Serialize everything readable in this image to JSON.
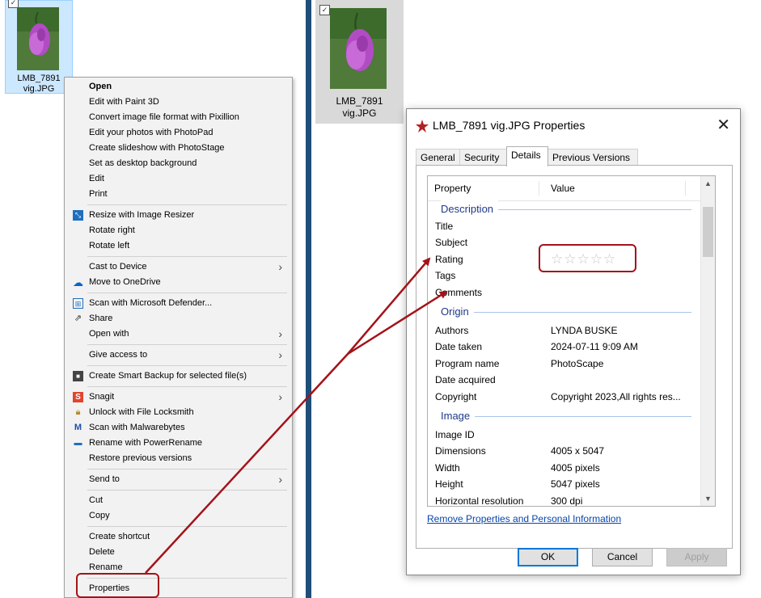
{
  "left_file": {
    "name_line1": "LMB_7891",
    "name_line2": "vig.JPG",
    "check": "✓"
  },
  "context_menu": {
    "items": [
      {
        "label": "Open",
        "bold": true,
        "icon": "",
        "arrow": false
      },
      {
        "label": "Edit with Paint 3D",
        "icon": "",
        "arrow": false
      },
      {
        "label": "Convert image file format with Pixillion",
        "icon": "",
        "arrow": false
      },
      {
        "label": "Edit your photos with PhotoPad",
        "icon": "",
        "arrow": false
      },
      {
        "label": "Create slideshow with PhotoStage",
        "icon": "",
        "arrow": false
      },
      {
        "label": "Set as desktop background",
        "icon": "",
        "arrow": false
      },
      {
        "label": "Edit",
        "icon": "",
        "arrow": false
      },
      {
        "label": "Print",
        "icon": "",
        "arrow": false
      },
      {
        "label": "Resize with Image Resizer",
        "icon": "image-resizer-icon",
        "arrow": false
      },
      {
        "label": "Rotate right",
        "icon": "",
        "arrow": false
      },
      {
        "label": "Rotate left",
        "icon": "",
        "arrow": false
      },
      {
        "label": "Cast to Device",
        "icon": "",
        "arrow": true
      },
      {
        "label": "Move to OneDrive",
        "icon": "onedrive-icon",
        "arrow": false
      },
      {
        "label": "Scan with Microsoft Defender...",
        "icon": "defender-icon",
        "arrow": false
      },
      {
        "label": "Share",
        "icon": "share-icon",
        "arrow": false
      },
      {
        "label": "Open with",
        "icon": "",
        "arrow": true
      },
      {
        "label": "Give access to",
        "icon": "",
        "arrow": true
      },
      {
        "label": "Create Smart Backup for selected file(s)",
        "icon": "smart-backup-icon",
        "arrow": false
      },
      {
        "label": "Snagit",
        "icon": "snagit-icon",
        "arrow": true
      },
      {
        "label": "Unlock with File Locksmith",
        "icon": "lock-icon",
        "arrow": false
      },
      {
        "label": "Scan with Malwarebytes",
        "icon": "malwarebytes-icon",
        "arrow": false
      },
      {
        "label": "Rename with PowerRename",
        "icon": "powerrename-icon",
        "arrow": false
      },
      {
        "label": "Restore previous versions",
        "icon": "",
        "arrow": false
      },
      {
        "label": "Send to",
        "icon": "",
        "arrow": true
      },
      {
        "label": "Cut",
        "icon": "",
        "arrow": false
      },
      {
        "label": "Copy",
        "icon": "",
        "arrow": false
      },
      {
        "label": "Create shortcut",
        "icon": "",
        "arrow": false
      },
      {
        "label": "Delete",
        "icon": "",
        "arrow": false
      },
      {
        "label": "Rename",
        "icon": "",
        "arrow": false
      },
      {
        "label": "Properties",
        "icon": "",
        "arrow": false
      }
    ]
  },
  "right_file": {
    "name_line1": "LMB_7891",
    "name_line2": "vig.JPG"
  },
  "dialog": {
    "title": "LMB_7891 vig.JPG Properties",
    "close": "✕",
    "tabs": [
      "General",
      "Security",
      "Details",
      "Previous Versions"
    ],
    "active_tab": "Details",
    "columns": {
      "property": "Property",
      "value": "Value"
    },
    "groups": {
      "description": "Description",
      "origin": "Origin",
      "image": "Image"
    },
    "rows": {
      "title": {
        "k": "Title",
        "v": ""
      },
      "subject": {
        "k": "Subject",
        "v": ""
      },
      "rating": {
        "k": "Rating",
        "stars": "☆☆☆☆☆",
        "value_stars": 0
      },
      "tags": {
        "k": "Tags",
        "v": ""
      },
      "comments": {
        "k": "Comments",
        "v": ""
      },
      "authors": {
        "k": "Authors",
        "v": "LYNDA BUSKE"
      },
      "date_taken": {
        "k": "Date taken",
        "v": "2024-07-11 9:09 AM"
      },
      "program": {
        "k": "Program name",
        "v": "PhotoScape"
      },
      "date_acquired": {
        "k": "Date acquired",
        "v": ""
      },
      "copyright": {
        "k": "Copyright",
        "v": "Copyright 2023,All rights res..."
      },
      "image_id": {
        "k": "Image ID",
        "v": ""
      },
      "dimensions": {
        "k": "Dimensions",
        "v": "4005 x 5047"
      },
      "width": {
        "k": "Width",
        "v": "4005 pixels"
      },
      "height": {
        "k": "Height",
        "v": "5047 pixels"
      },
      "hres": {
        "k": "Horizontal resolution",
        "v": "300 dpi"
      }
    },
    "link": "Remove Properties and Personal Information",
    "buttons": {
      "ok": "OK",
      "cancel": "Cancel",
      "apply": "Apply"
    }
  },
  "colors": {
    "highlight": "#a3131a",
    "divider": "#1f4e79",
    "selection": "#cce8ff"
  }
}
